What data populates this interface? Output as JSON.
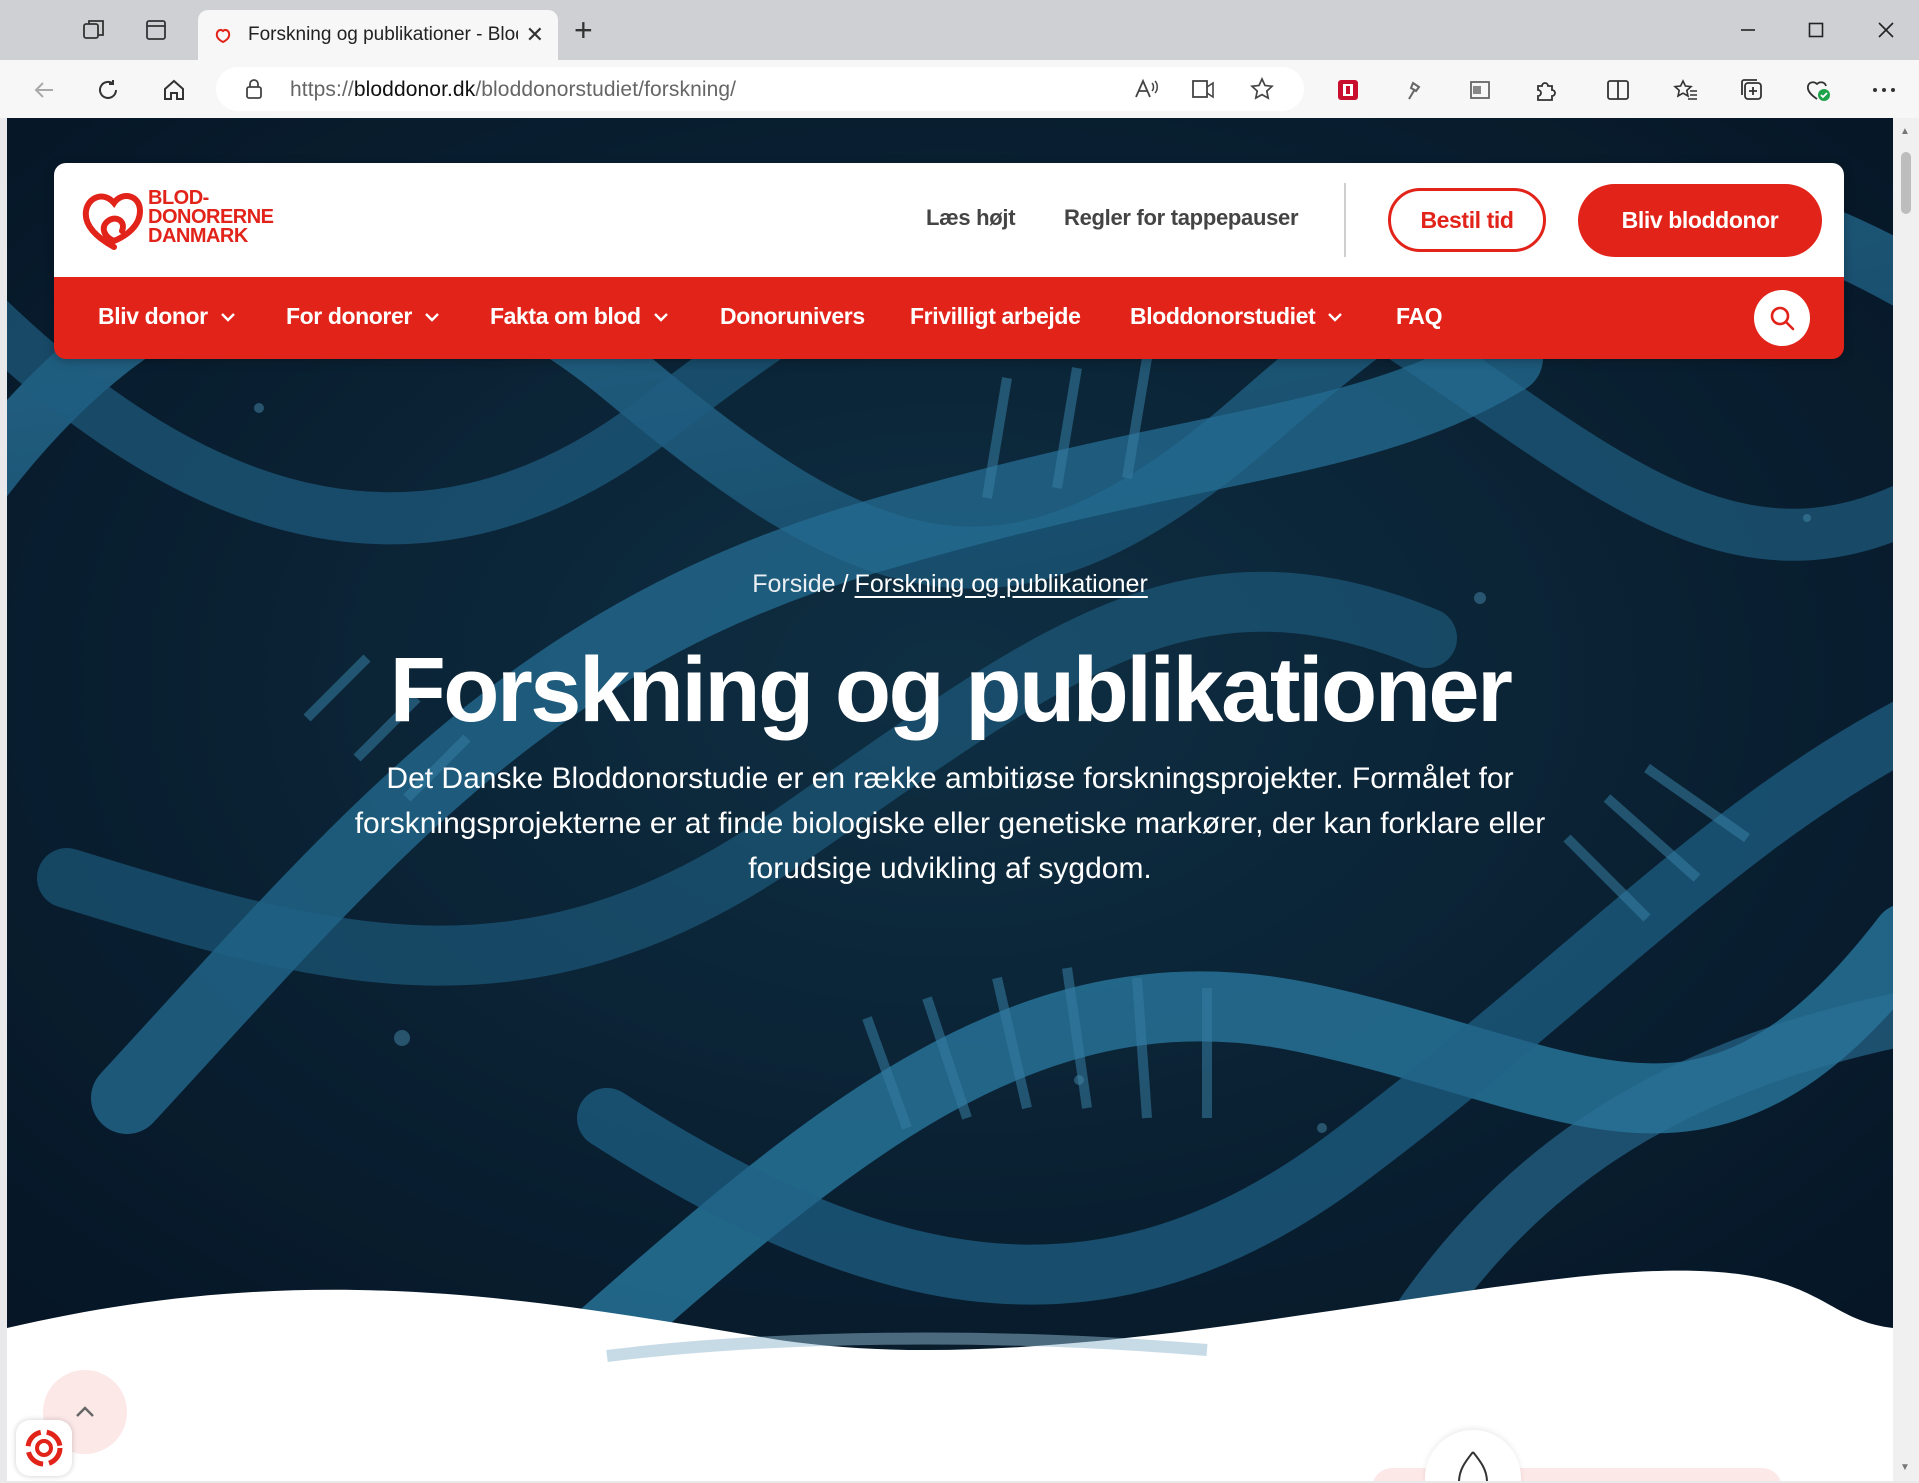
{
  "browser": {
    "tab_title": "Forskning og publikationer - Blod",
    "url_prefix": "https://",
    "url_host": "bloddonor.dk",
    "url_path": "/bloddonorstudiet/forskning/",
    "new_tab_label": "+",
    "tab_close_label": "✕"
  },
  "header": {
    "logo_line1": "BLOD-",
    "logo_line2": "DONORERNE",
    "logo_line3": "DANMARK",
    "utility_links": [
      "Læs højt",
      "Regler for tappepauser"
    ],
    "btn_book": "Bestil tid",
    "btn_donor": "Bliv bloddonor"
  },
  "nav": {
    "items": [
      {
        "label": "Bliv donor",
        "dropdown": true
      },
      {
        "label": "For donorer",
        "dropdown": true
      },
      {
        "label": "Fakta om blod",
        "dropdown": true
      },
      {
        "label": "Donorunivers",
        "dropdown": false
      },
      {
        "label": "Frivilligt arbejde",
        "dropdown": false
      },
      {
        "label": "Bloddonorstudiet",
        "dropdown": true
      },
      {
        "label": "FAQ",
        "dropdown": false
      }
    ]
  },
  "hero": {
    "breadcrumb_home": "Forside",
    "breadcrumb_sep": "/",
    "breadcrumb_current": "Forskning og publikationer",
    "title": "Forskning og publikationer",
    "lead": "Det Danske Bloddonorstudie er en række ambitiøse forskningsprojekter. Formålet for forskningsprojekterne er at finde biologiske eller genetiske markører, der kan forklare eller forudsige udvikling af sygdom."
  },
  "colors": {
    "brand_red": "#e2231a",
    "hero_dark": "#0b2233",
    "dna_blue": "#2f86b3"
  }
}
